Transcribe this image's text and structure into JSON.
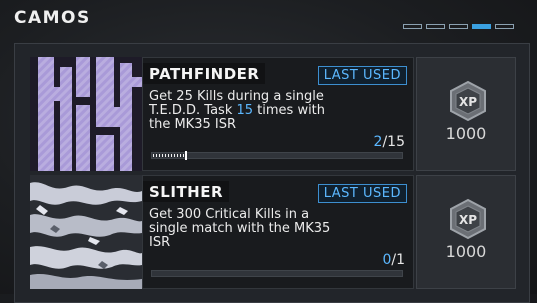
{
  "page": {
    "title": "CAMOS"
  },
  "pager": {
    "count": 5,
    "active": 4
  },
  "camos": [
    {
      "name": "PATHFINDER",
      "badge": "LAST USED",
      "desc_before": "Get 25 Kills during a single T.E.D.D. Task ",
      "desc_highlight": "15",
      "desc_after": " times with the MK35 ISR",
      "progress_current": "2",
      "progress_total": "/15",
      "progress_fraction": 0.133,
      "xp_icon": "xp-hexagon-icon",
      "xp_value": "1000"
    },
    {
      "name": "SLITHER",
      "badge": "LAST USED",
      "desc_before": "Get 300 Critical Kills in a single match with the MK35 ISR",
      "desc_highlight": "",
      "desc_after": "",
      "progress_current": "0",
      "progress_total": "/1",
      "progress_fraction": 0.0,
      "xp_icon": "xp-hexagon-icon",
      "xp_value": "1000"
    }
  ],
  "colors": {
    "accent": "#5cb8ff",
    "panel": "#22252a",
    "info_bg": "#191b1e"
  }
}
